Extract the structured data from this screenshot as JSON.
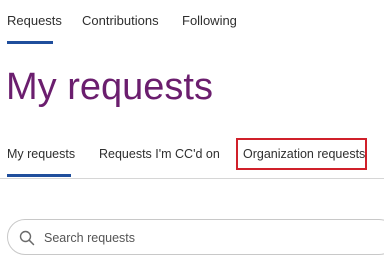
{
  "top_nav": {
    "tabs": [
      {
        "label": "Requests",
        "active": true
      },
      {
        "label": "Contributions",
        "active": false
      },
      {
        "label": "Following",
        "active": false
      }
    ]
  },
  "page_title": "My requests",
  "sub_tabs": [
    {
      "label": "My requests",
      "active": true
    },
    {
      "label": "Requests I'm CC'd on",
      "active": false
    },
    {
      "label": "Organization requests",
      "active": false,
      "highlighted": true
    }
  ],
  "search": {
    "placeholder": "Search requests",
    "value": ""
  },
  "colors": {
    "title": "#6b1e6e",
    "active_underline": "#1f4e9c",
    "highlight_box": "#d0202a"
  },
  "icons": {
    "search": "search-icon"
  }
}
